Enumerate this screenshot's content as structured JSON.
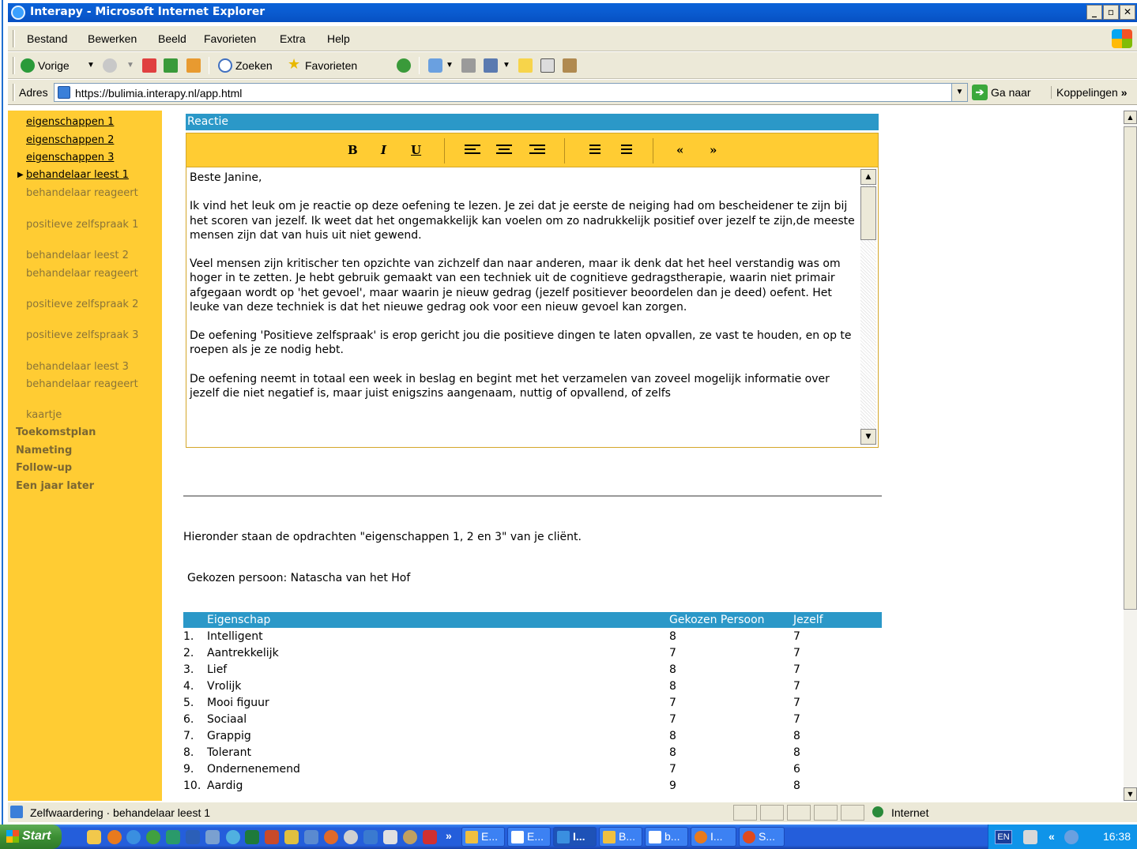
{
  "window": {
    "title": "Interapy - Microsoft Internet Explorer",
    "buttons": [
      "_",
      "á",
      "×"
    ]
  },
  "menu": [
    "Bestand",
    "Bewerken",
    "Beeld",
    "Favorieten",
    "Extra",
    "Help"
  ],
  "toolbar": {
    "back": "Vorige",
    "search": "Zoeken",
    "favorites": "Favorieten"
  },
  "address": {
    "label": "Adres",
    "url": "https://bulimia.interapy.nl/app.html",
    "go": "Ga naar",
    "links": "Koppelingen"
  },
  "sidebar": {
    "sub_links": [
      "eigenschappen 1",
      "eigenschappen 2",
      "eigenschappen 3",
      "behandelaar leest 1"
    ],
    "sub_dim": [
      "behandelaar reageert",
      "positieve zelfspraak 1",
      "behandelaar leest 2",
      "behandelaar reageert",
      "positieve zelfspraak 2",
      "positieve zelfspraak 3",
      "behandelaar leest 3",
      "behandelaar reageert",
      "kaartje"
    ],
    "main": [
      "Toekomstplan",
      "Nameting",
      "Follow-up",
      "Een jaar later"
    ]
  },
  "editor": {
    "header": "Reactie",
    "buttons": {
      "bold": "B",
      "italic": "I",
      "underline": "U",
      "prev": "«",
      "next": "»"
    },
    "text": "Beste Janine,\n\nIk vind het leuk om je reactie op deze oefening te lezen. Je zei dat je eerste de neiging had om bescheidener te zijn bij het scoren van jezelf. Ik weet dat het ongemakkelijk kan voelen om zo nadrukkelijk positief over jezelf te zijn,de meeste mensen zijn dat van huis uit niet gewend.\n\nVeel mensen zijn kritischer ten opzichte van zichzelf dan naar anderen, maar ik denk dat het heel verstandig was om hoger in te zetten. Je hebt gebruik gemaakt van een techniek uit de cognitieve gedragstherapie, waarin niet primair afgegaan wordt op 'het gevoel', maar waarin je nieuw gedrag (jezelf positiever beoordelen dan je deed) oefent. Het leuke van deze techniek is dat het nieuwe gedrag ook voor een nieuw gevoel kan zorgen.\n\nDe oefening 'Positieve zelfspraak' is erop gericht jou die positieve dingen te laten opvallen, ze vast te houden, en op te roepen als je ze nodig hebt.\n\nDe oefening neemt in totaal een week in beslag en begint met het verzamelen van zoveel mogelijk informatie over jezelf die niet negatief is, maar juist enigszins aangenaam, nuttig of opvallend, of zelfs"
  },
  "main": {
    "intro": "Hieronder staan de opdrachten \"eigenschappen 1, 2 en 3\" van je cliënt.",
    "chosen": "Gekozen persoon: Natascha van het Hof"
  },
  "table": {
    "headers": [
      "Eigenschap",
      "Gekozen Persoon",
      "Jezelf"
    ],
    "rows": [
      {
        "num": "1.",
        "name": "Intelligent",
        "person": "8",
        "self": "7"
      },
      {
        "num": "2.",
        "name": "Aantrekkelijk",
        "person": "7",
        "self": "7"
      },
      {
        "num": "3.",
        "name": "Lief",
        "person": "8",
        "self": "7"
      },
      {
        "num": "4.",
        "name": "Vrolijk",
        "person": "8",
        "self": "7"
      },
      {
        "num": "5.",
        "name": "Mooi figuur",
        "person": "7",
        "self": "7"
      },
      {
        "num": "6.",
        "name": "Sociaal",
        "person": "7",
        "self": "7"
      },
      {
        "num": "7.",
        "name": "Grappig",
        "person": "8",
        "self": "8"
      },
      {
        "num": "8.",
        "name": "Tolerant",
        "person": "8",
        "self": "8"
      },
      {
        "num": "9.",
        "name": "Ondernenemend",
        "person": "7",
        "self": "6"
      },
      {
        "num": "10.",
        "name": "Aardig",
        "person": "9",
        "self": "8"
      }
    ]
  },
  "status": {
    "text": "Zelfwaardering · behandelaar leest 1",
    "zone": "Internet"
  },
  "taskbar": {
    "start": "Start",
    "tasks": [
      "E...",
      "E...",
      "I...",
      "B...",
      "b...",
      "I...",
      "S..."
    ],
    "lang": "EN",
    "clock": "16:38"
  },
  "colors": {
    "sidebar": "#ffcc33",
    "header_blue": "#2b98c8",
    "xp_blue": "#245edb"
  }
}
